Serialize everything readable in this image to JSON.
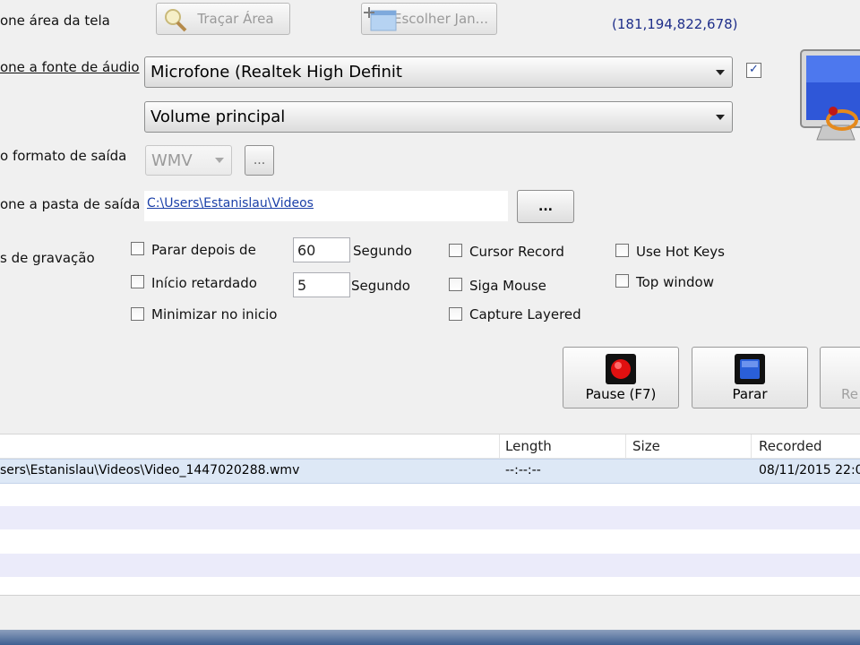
{
  "screen_area": {
    "label": "one área da tela",
    "trace_button": "Traçar Área",
    "choose_window_button": "Escolher Jan...",
    "coordinates": "(181,194,822,678)"
  },
  "audio": {
    "label": "one a fonte de áudio",
    "device": "Microfone (Realtek High Definit",
    "checked": true,
    "volume_source": "Volume principal"
  },
  "output_format": {
    "label": "o formato de saída",
    "value": "WMV",
    "more_button": "..."
  },
  "output_folder": {
    "label": "one a pasta de saída",
    "path": "C:\\Users\\Estanislau\\Videos",
    "browse_button": "..."
  },
  "recording_options": {
    "label": "s de gravação",
    "stop_after": {
      "label": "Parar depois de",
      "value": "60",
      "unit": "Segundo",
      "checked": false
    },
    "delayed_start": {
      "label": "Início retardado",
      "value": "5",
      "unit": "Segundo",
      "checked": false
    },
    "minimize": {
      "label": "Minimizar no inicio",
      "checked": false
    },
    "cursor_record": {
      "label": "Cursor Record",
      "checked": false
    },
    "follow_mouse": {
      "label": "Siga Mouse",
      "checked": false
    },
    "capture_layered": {
      "label": "Capture Layered",
      "checked": false
    },
    "hot_keys": {
      "label": "Use Hot Keys",
      "checked": false
    },
    "top_window": {
      "label": "Top window",
      "checked": false
    }
  },
  "actions": {
    "pause": "Pause (F7)",
    "stop": "Parar",
    "third_partial": "Re"
  },
  "file_list": {
    "columns": {
      "length": "Length",
      "size": "Size",
      "recorded": "Recorded"
    },
    "rows": [
      {
        "name": "sers\\Estanislau\\Videos\\Video_1447020288.wmv",
        "length": "--:--:--",
        "size": "",
        "recorded": "08/11/2015 22:0"
      }
    ]
  },
  "colors": {
    "accent_link": "#1a3fa8",
    "coords_text": "#1f2f8a",
    "row_alt": "#ebebfa",
    "row_selected": "#dde8f6",
    "record_red": "#e01010",
    "stop_blue": "#2a5fd8"
  }
}
